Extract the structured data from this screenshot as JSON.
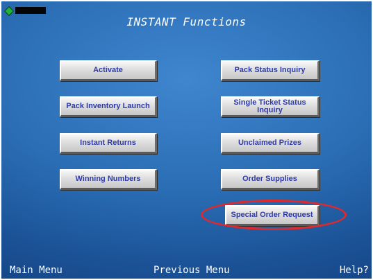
{
  "status": {
    "indicator_icon": "green-diamond-icon",
    "indicator_color": "#21b33a"
  },
  "title": "INSTANT Functions",
  "buttons": {
    "left": [
      "Activate",
      "Pack Inventory Launch",
      "Instant Returns",
      "Winning Numbers"
    ],
    "right": [
      "Pack Status Inquiry",
      "Single Ticket Status Inquiry",
      "Unclaimed Prizes",
      "Order Supplies",
      "Special Order Request"
    ]
  },
  "highlight": {
    "target": "Special Order Request",
    "color": "#e3282b"
  },
  "footer": {
    "main_menu": "Main Menu",
    "previous_menu": "Previous Menu",
    "help": "Help?"
  },
  "colors": {
    "background": "#2a6db4",
    "button_text": "#2e3aa8",
    "button_face": "#dedede"
  }
}
